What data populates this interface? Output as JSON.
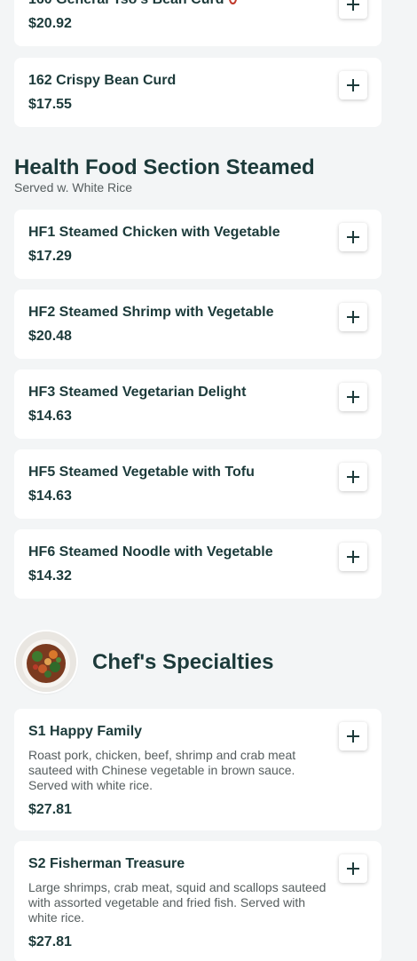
{
  "colors": {
    "background": "#f3f5f6",
    "card": "#ffffff",
    "text": "#1c3a3a",
    "muted": "#555d5e",
    "spicy": "#c0392b"
  },
  "top_items": [
    {
      "name": "160 General Tso's Bean Curd",
      "price": "$20.92",
      "spicy": true
    },
    {
      "name": "162 Crispy Bean Curd",
      "price": "$17.55"
    }
  ],
  "health_section": {
    "title": "Health Food Section Steamed",
    "subtitle": "Served w. White Rice",
    "items": [
      {
        "name": "HF1 Steamed Chicken with Vegetable",
        "price": "$17.29"
      },
      {
        "name": "HF2 Steamed Shrimp with Vegetable",
        "price": "$20.48"
      },
      {
        "name": "HF3 Steamed Vegetarian Delight",
        "price": "$14.63"
      },
      {
        "name": "HF5 Steamed Vegetable with Tofu",
        "price": "$14.63"
      },
      {
        "name": "HF6 Steamed Noodle with Vegetable",
        "price": "$14.32"
      }
    ]
  },
  "chef_section": {
    "title": "Chef's Specialties",
    "image_icon": "dish-photo",
    "items": [
      {
        "name": "S1 Happy Family",
        "description": "Roast pork, chicken, beef, shrimp and crab meat sauteed with Chinese vegetable in brown sauce. Served with white rice.",
        "price": "$27.81"
      },
      {
        "name": "S2 Fisherman Treasure",
        "description": "Large shrimps, crab meat, squid and scallops sauteed with assorted vegetable and fried fish. Served with white rice.",
        "price": "$27.81"
      }
    ]
  },
  "icons": {
    "add": "plus-icon",
    "spicy": "chili-pepper-icon"
  }
}
